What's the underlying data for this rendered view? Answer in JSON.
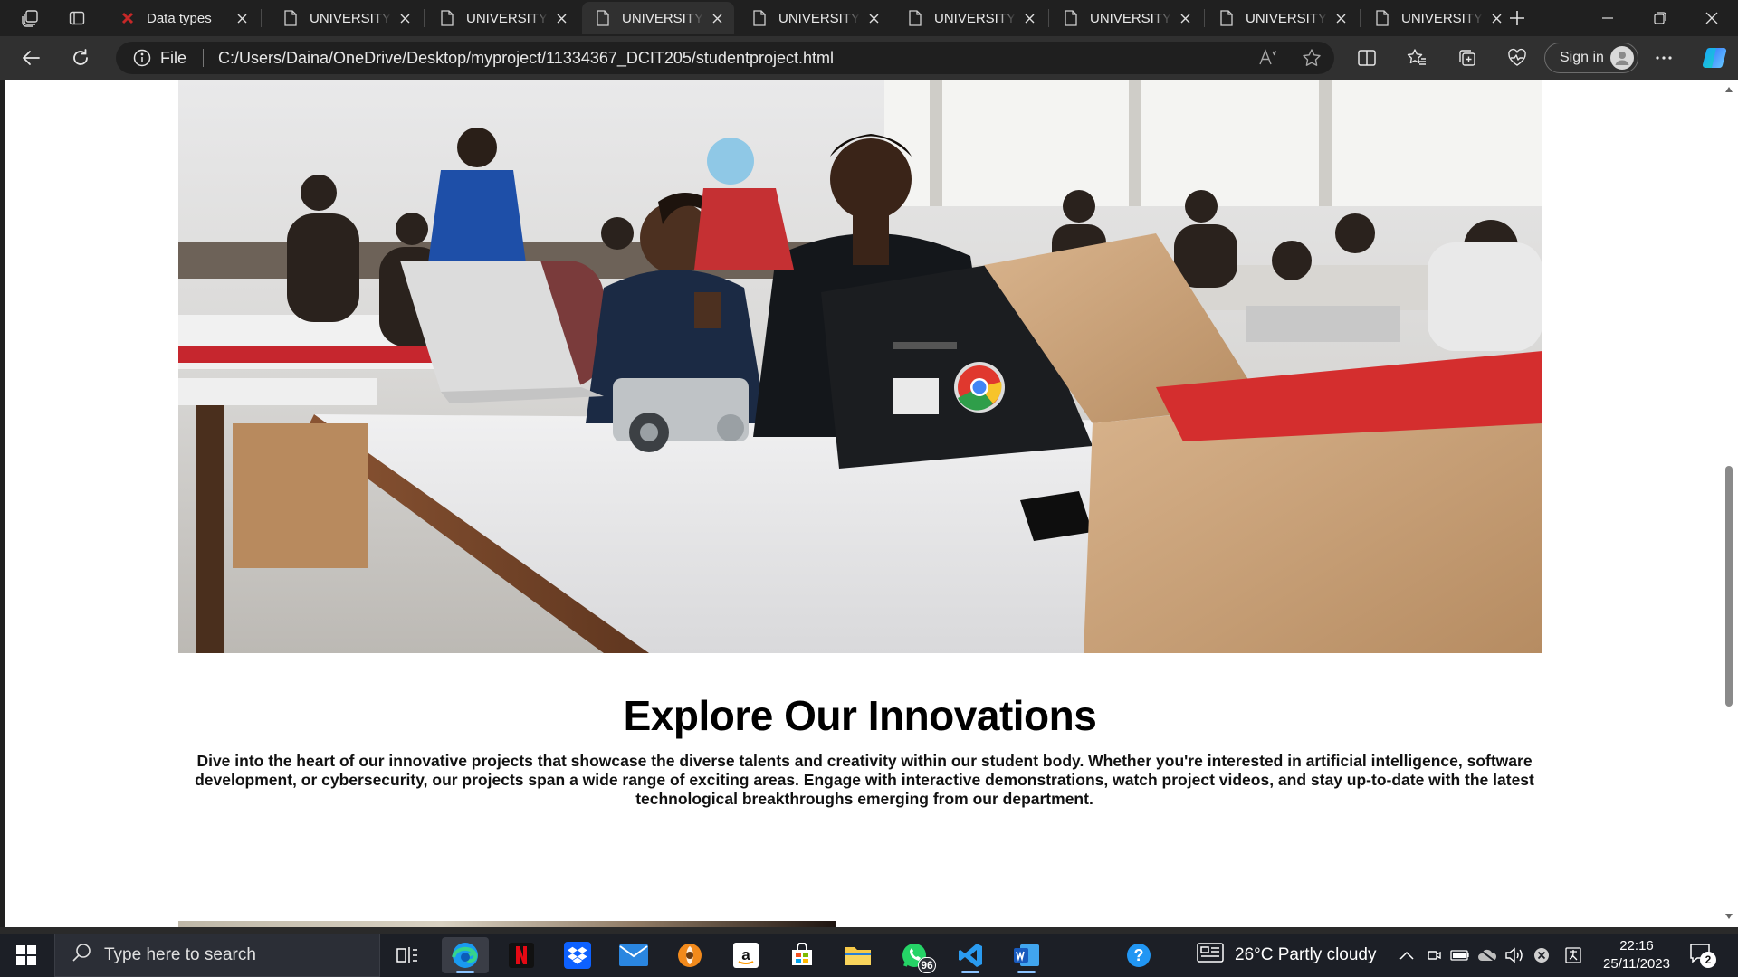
{
  "browser": {
    "tabs": [
      {
        "title": "Data types",
        "active": false,
        "icon": "red-x-favicon"
      },
      {
        "title": "UNIVERSITY OF GHANA",
        "active": false,
        "icon": "page-icon"
      },
      {
        "title": "UNIVERSITY OF GHANA",
        "active": false,
        "icon": "page-icon"
      },
      {
        "title": "UNIVERSITY OF GHANA",
        "active": true,
        "icon": "page-icon"
      },
      {
        "title": "UNIVERSITY OF GHANA",
        "active": false,
        "icon": "page-icon"
      },
      {
        "title": "UNIVERSITY OF GHANA",
        "active": false,
        "icon": "page-icon"
      },
      {
        "title": "UNIVERSITY OF GHANA",
        "active": false,
        "icon": "page-icon"
      },
      {
        "title": "UNIVERSITY OF GHANA",
        "active": false,
        "icon": "page-icon"
      },
      {
        "title": "UNIVERSITY OF GHANA",
        "active": false,
        "icon": "page-icon"
      }
    ],
    "address": {
      "scheme_label": "File",
      "url": "C:/Users/Daina/OneDrive/Desktop/myproject/11334367_DCIT205/studentproject.html"
    },
    "signin_label": "Sign in"
  },
  "page": {
    "section_title": "Explore Our Innovations",
    "section_body": "Dive into the heart of our innovative projects that showcase the diverse talents and creativity within our student body. Whether you're interested in artificial intelligence, software development, or cybersecurity, our projects span a wide range of exciting areas. Engage with interactive demonstrations, watch project videos, and stay up-to-date with the latest technological breakthroughs emerging from our department."
  },
  "taskbar": {
    "search_placeholder": "Type here to search",
    "whatsapp_badge": "96",
    "weather": "26°C  Partly cloudy",
    "time": "22:16",
    "date": "25/11/2023",
    "notification_count": "2"
  },
  "colors": {
    "chrome_dark": "#202020",
    "toolbar": "#303030",
    "taskbar": "#1c1f26",
    "accent": "#0078d4"
  }
}
